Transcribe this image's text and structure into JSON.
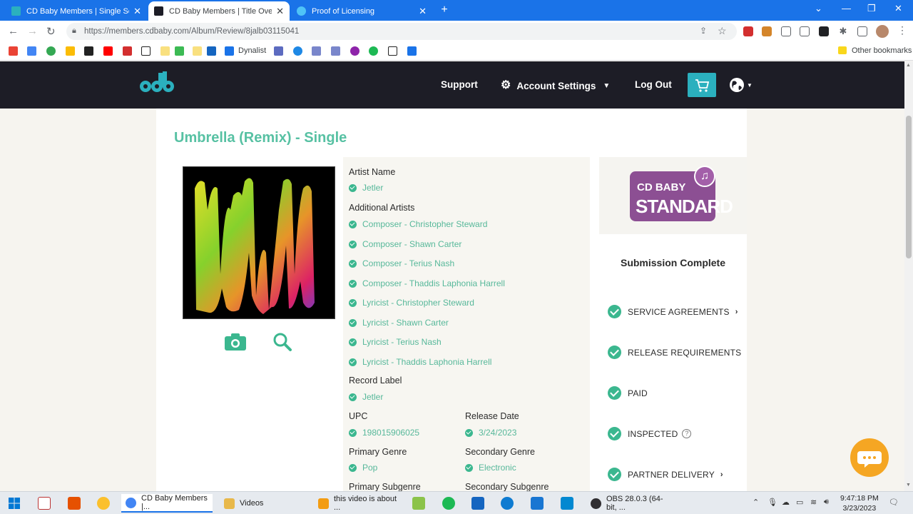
{
  "browser": {
    "tabs": [
      {
        "title": "CD Baby Members | Single Song",
        "favicon_color": "#2bb0be",
        "active": false
      },
      {
        "title": "CD Baby Members | Title Overvie",
        "favicon_color": "#1d1d26",
        "active": true
      },
      {
        "title": "Proof of Licensing",
        "favicon_color": "#4fc3f7",
        "active": false
      }
    ],
    "new_tab": "+",
    "url": "https://members.cdbaby.com/Album/Review/8jalb03115041",
    "bookmarks": {
      "dynalist_label": "Dynalist",
      "other_label": "Other bookmarks"
    }
  },
  "site": {
    "nav": {
      "support": "Support",
      "account_settings": "Account Settings",
      "log_out": "Log Out"
    },
    "accent_color": "#2bb0be",
    "header_color": "#1d1d26"
  },
  "album": {
    "title": "Umbrella (Remix) - Single",
    "artist_name_label": "Artist Name",
    "artist_name": "Jetler",
    "additional_artists_label": "Additional Artists",
    "additional_artists": [
      "Composer - Christopher Steward",
      "Composer - Shawn Carter",
      "Composer - Terius Nash",
      "Composer - Thaddis Laphonia Harrell",
      "Lyricist - Christopher Steward",
      "Lyricist - Shawn Carter",
      "Lyricist - Terius Nash",
      "Lyricist - Thaddis Laphonia Harrell"
    ],
    "record_label_label": "Record Label",
    "record_label": "Jetler",
    "upc_label": "UPC",
    "upc": "198015906025",
    "release_date_label": "Release Date",
    "release_date": "3/24/2023",
    "primary_genre_label": "Primary Genre",
    "primary_genre": "Pop",
    "secondary_genre_label": "Secondary Genre",
    "secondary_genre": "Electronic",
    "primary_subgenre_label": "Primary Subgenre",
    "secondary_subgenre_label": "Secondary Subgenre"
  },
  "status": {
    "badge_line1": "CD BABY",
    "badge_line2": "STANDARD",
    "badge_color": "#8c4f93",
    "submission_title": "Submission Complete",
    "steps": [
      {
        "label": "SERVICE AGREEMENTS",
        "arrow": "›"
      },
      {
        "label": "RELEASE REQUIREMENTS"
      },
      {
        "label": "PAID"
      },
      {
        "label": "INSPECTED",
        "help": "?"
      },
      {
        "label": "PARTNER DELIVERY",
        "arrow": "›"
      }
    ]
  },
  "taskbar": {
    "apps": [
      {
        "label": "CD Baby Members |...",
        "color": "#4285f4"
      },
      {
        "label": "Videos",
        "color": "#e8b84a"
      },
      {
        "label": "this video is about ...",
        "color": "#f39c12"
      },
      {
        "label": "OBS 28.0.3 (64-bit, ...",
        "color": "#302e31"
      }
    ],
    "time": "9:47:18 PM",
    "date": "3/23/2023"
  }
}
